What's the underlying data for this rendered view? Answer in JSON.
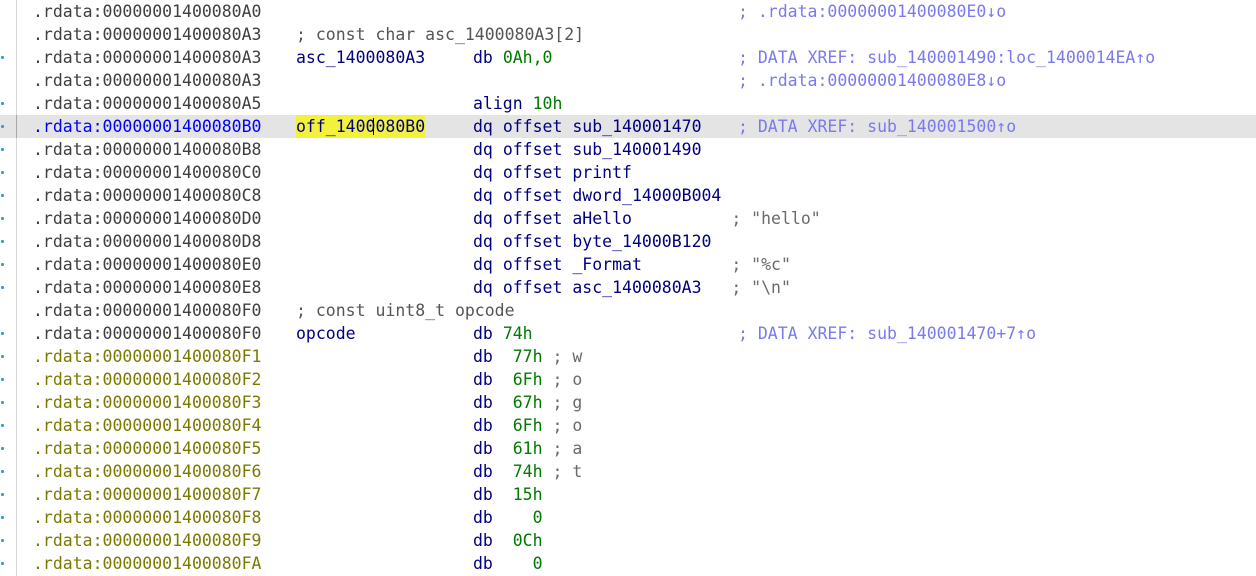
{
  "listing": [
    {
      "addr": ".rdata:00000001400080A0",
      "xref": "; .rdata:00000001400080E0↓o",
      "dot": false
    },
    {
      "addr": ".rdata:00000001400080A3",
      "comment": "; const char asc_1400080A3[2]",
      "dot": false
    },
    {
      "addr": ".rdata:00000001400080A3",
      "label": "asc_1400080A3",
      "mnemonic": "db",
      "operand": "0Ah,0",
      "xref": "; DATA XREF: sub_140001490:loc_1400014EA↑o",
      "dot": true
    },
    {
      "addr": ".rdata:00000001400080A3",
      "xref": "; .rdata:00000001400080E8↓o",
      "dot": false
    },
    {
      "addr": ".rdata:00000001400080A5",
      "mnemonic": "align",
      "operand": "10h",
      "dot": true
    },
    {
      "addr": ".rdata:00000001400080B0",
      "label": "off_1400080B0",
      "mnemonic": "dq",
      "operand": "offset sub_140001470",
      "xref": "; DATA XREF: sub_140001500↑o",
      "dot": true,
      "selected": true
    },
    {
      "addr": ".rdata:00000001400080B8",
      "mnemonic": "dq",
      "operand": "offset sub_140001490",
      "dot": true
    },
    {
      "addr": ".rdata:00000001400080C0",
      "mnemonic": "dq",
      "operand": "offset printf",
      "dot": true
    },
    {
      "addr": ".rdata:00000001400080C8",
      "mnemonic": "dq",
      "operand": "offset dword_14000B004",
      "dot": true
    },
    {
      "addr": ".rdata:00000001400080D0",
      "mnemonic": "dq",
      "operand": "offset aHello",
      "inline_comment": "; \"hello\"",
      "dot": true
    },
    {
      "addr": ".rdata:00000001400080D8",
      "mnemonic": "dq",
      "operand": "offset byte_14000B120",
      "dot": true
    },
    {
      "addr": ".rdata:00000001400080E0",
      "mnemonic": "dq",
      "operand": "offset _Format",
      "inline_comment": "; \"%c\"",
      "dot": true
    },
    {
      "addr": ".rdata:00000001400080E8",
      "mnemonic": "dq",
      "operand": "offset asc_1400080A3",
      "inline_comment": "; \"\\n\"",
      "dot": true
    },
    {
      "addr": ".rdata:00000001400080F0",
      "comment": "; const uint8_t opcode",
      "dot": false
    },
    {
      "addr": ".rdata:00000001400080F0",
      "label": "opcode",
      "mnemonic": "db",
      "operand": "74h",
      "xref": "; DATA XREF: sub_140001470+7↑o",
      "dot": true
    },
    {
      "addr": ".rdata:00000001400080F1",
      "mnemonic": "db",
      "operand": " 77h",
      "char_comment": "; w",
      "dot": true,
      "undefined": true
    },
    {
      "addr": ".rdata:00000001400080F2",
      "mnemonic": "db",
      "operand": " 6Fh",
      "char_comment": "; o",
      "dot": true,
      "undefined": true
    },
    {
      "addr": ".rdata:00000001400080F3",
      "mnemonic": "db",
      "operand": " 67h",
      "char_comment": "; g",
      "dot": true,
      "undefined": true
    },
    {
      "addr": ".rdata:00000001400080F4",
      "mnemonic": "db",
      "operand": " 6Fh",
      "char_comment": "; o",
      "dot": true,
      "undefined": true
    },
    {
      "addr": ".rdata:00000001400080F5",
      "mnemonic": "db",
      "operand": " 61h",
      "char_comment": "; a",
      "dot": true,
      "undefined": true
    },
    {
      "addr": ".rdata:00000001400080F6",
      "mnemonic": "db",
      "operand": " 74h",
      "char_comment": "; t",
      "dot": true,
      "undefined": true
    },
    {
      "addr": ".rdata:00000001400080F7",
      "mnemonic": "db",
      "operand": " 15h",
      "dot": true,
      "undefined": true
    },
    {
      "addr": ".rdata:00000001400080F8",
      "mnemonic": "db",
      "operand": "   0",
      "dot": true,
      "undefined": true
    },
    {
      "addr": ".rdata:00000001400080F9",
      "mnemonic": "db",
      "operand": " 0Ch",
      "dot": true,
      "undefined": true
    },
    {
      "addr": ".rdata:00000001400080FA",
      "mnemonic": "db",
      "operand": "   0",
      "dot": true,
      "undefined": true
    }
  ]
}
